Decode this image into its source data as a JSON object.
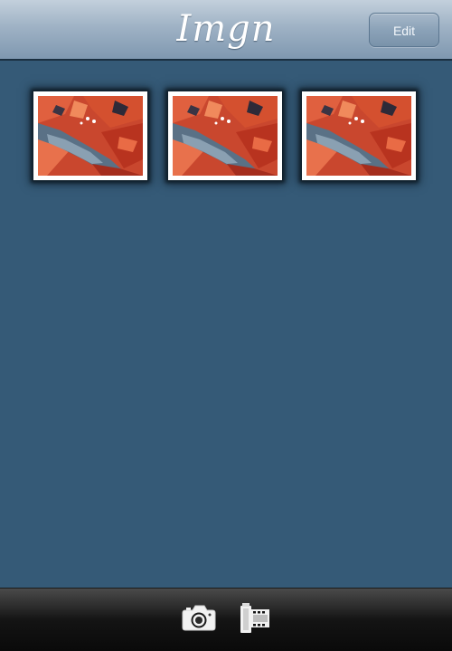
{
  "header": {
    "title": "Imgn",
    "edit_label": "Edit"
  },
  "gallery": {
    "items": [
      {
        "icon": "photo-thumbnail"
      },
      {
        "icon": "photo-thumbnail"
      },
      {
        "icon": "photo-thumbnail"
      }
    ]
  },
  "tabbar": {
    "items": [
      {
        "icon": "camera-icon"
      },
      {
        "icon": "film-roll-icon"
      }
    ]
  },
  "colors": {
    "background": "#355a77",
    "navbar_top": "#c3d0dc",
    "navbar_bottom": "#7f98b0",
    "tabbar": "#141414"
  }
}
